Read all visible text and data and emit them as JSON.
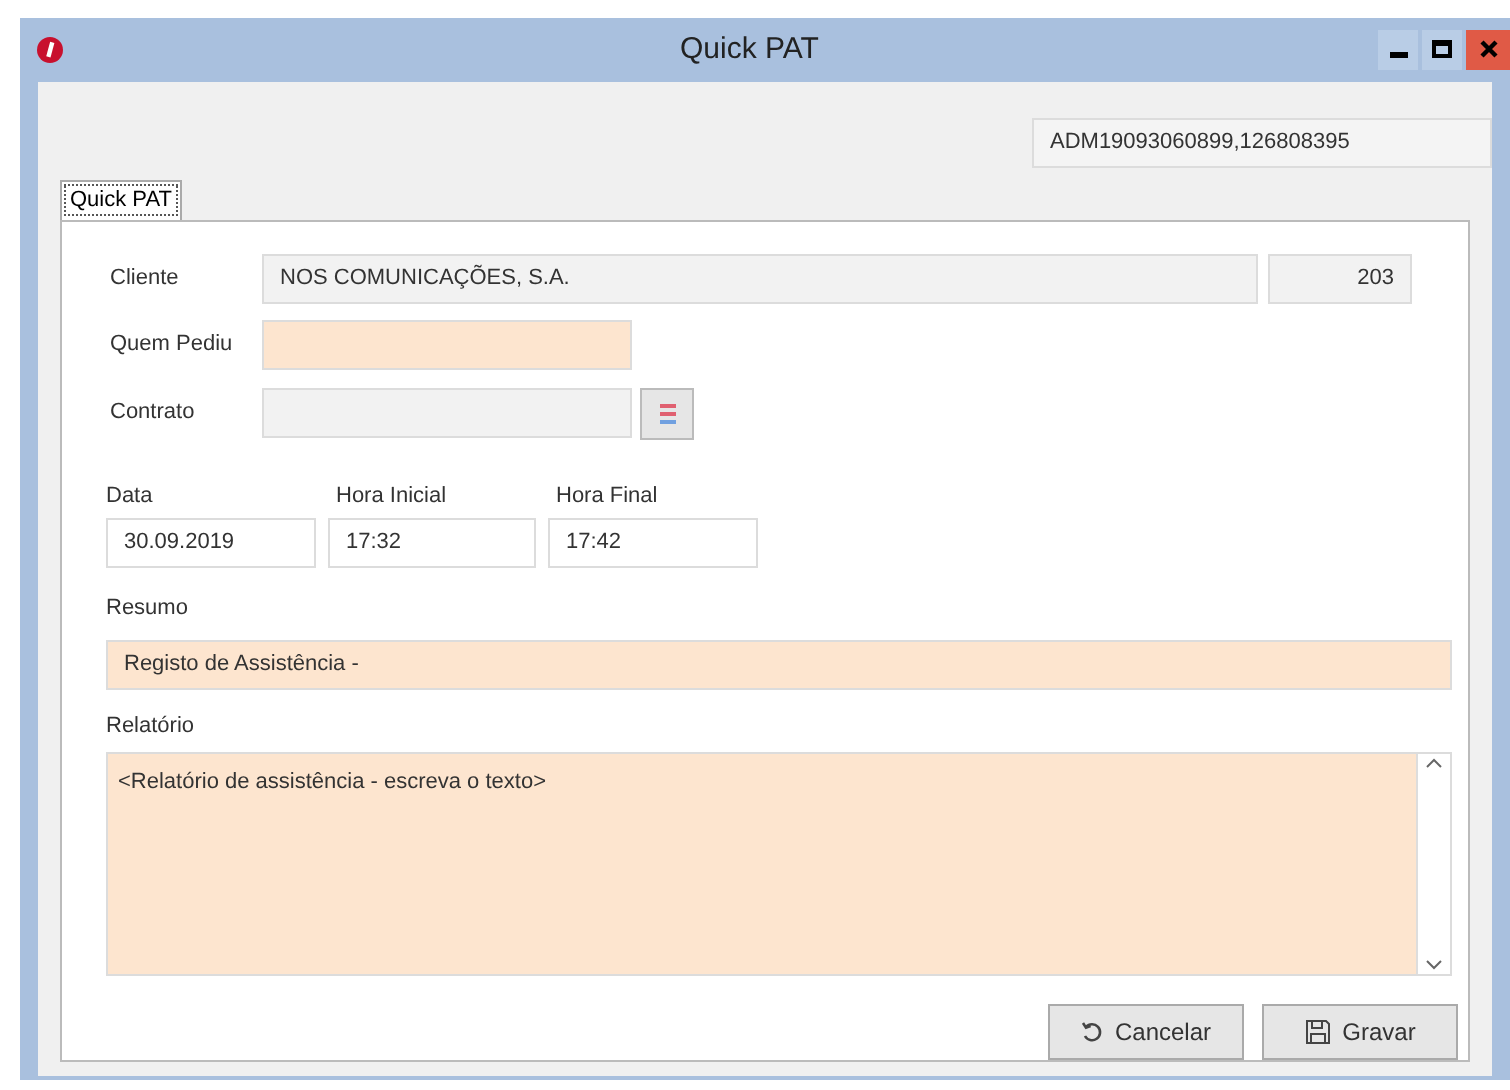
{
  "window": {
    "title": "Quick PAT"
  },
  "record_id": "ADM19093060899,126808395",
  "tabs": [
    {
      "label": "Quick PAT",
      "selected": true
    }
  ],
  "form": {
    "cliente": {
      "label": "Cliente",
      "value": "NOS COMUNICAÇÕES, S.A.",
      "code": "203"
    },
    "quem_pediu": {
      "label": "Quem Pediu"
    },
    "contrato": {
      "label": "Contrato"
    },
    "data": {
      "label": "Data",
      "value": "30.09.2019"
    },
    "hora_inicial": {
      "label": "Hora Inicial",
      "value": "17:32"
    },
    "hora_final": {
      "label": "Hora Final",
      "value": "17:42"
    },
    "resumo": {
      "label": "Resumo",
      "value": "Registo de Assistência -"
    },
    "relatorio": {
      "label": "Relatório",
      "value": "<Relatório de assistência - escreva o texto>"
    }
  },
  "buttons": [
    {
      "label": "Cancelar",
      "kind": "cancel"
    },
    {
      "label": "Gravar",
      "kind": "save"
    }
  ]
}
